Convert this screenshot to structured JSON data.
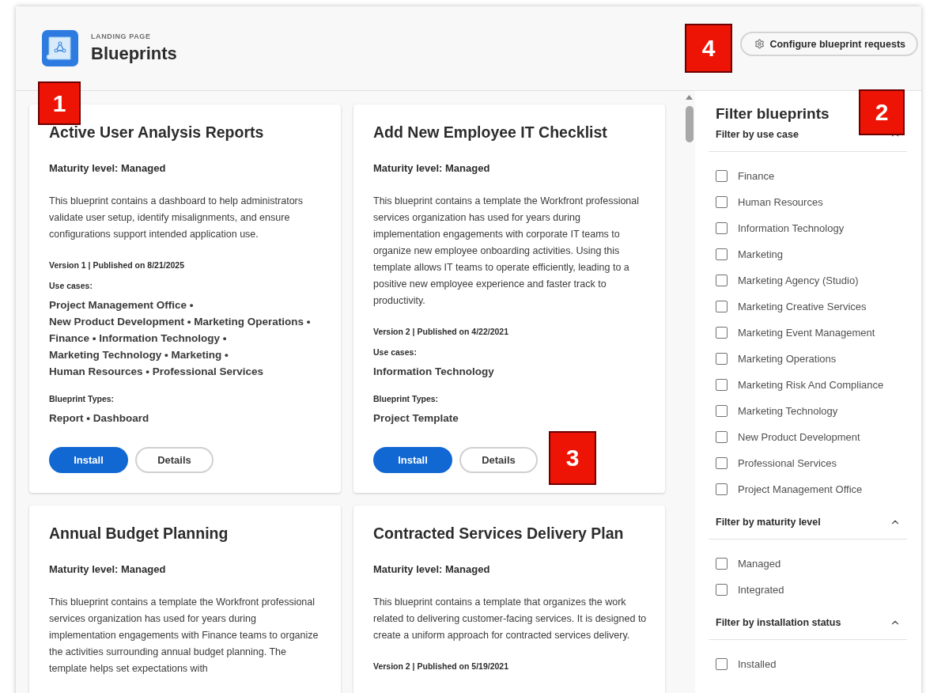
{
  "header": {
    "eyebrow": "LANDING PAGE",
    "title": "Blueprints",
    "action": "Configure blueprint requests"
  },
  "cards": [
    {
      "title": "Active User Analysis Reports",
      "maturity": "Maturity level: Managed",
      "description": "This blueprint contains a dashboard to help administrators validate user setup, identify misalignments, and ensure configurations support intended application use.",
      "version": "Version 1 | Published on 8/21/2025",
      "use_cases_label": "Use cases:",
      "use_cases": [
        "Project Management Office •",
        "New Product Development •",
        "Marketing Operations •",
        "Finance •",
        "Information Technology •",
        "Marketing Technology •",
        "Marketing •",
        "Human Resources •",
        "Professional Services"
      ],
      "types_label": "Blueprint Types:",
      "types": [
        "Report •",
        "Dashboard"
      ],
      "buttons": [
        {
          "label": "Install",
          "kind": "primary"
        },
        {
          "label": "Details",
          "kind": "secondary"
        }
      ]
    },
    {
      "title": "Add New Employee IT Checklist",
      "maturity": "Maturity level: Managed",
      "description": "This blueprint contains a template the Workfront professional services organization has used for years during implementation engagements with corporate IT teams to organize new employee onboarding activities. Using this template allows IT teams to operate efficiently, leading to a positive new employee experience and faster track to productivity.",
      "version": "Version 2 | Published on 4/22/2021",
      "use_cases_label": "Use cases:",
      "use_cases": [
        "Information Technology"
      ],
      "types_label": "Blueprint Types:",
      "types": [
        "Project Template"
      ],
      "buttons": [
        {
          "label": "Install",
          "kind": "primary"
        },
        {
          "label": "Details",
          "kind": "secondary"
        }
      ]
    },
    {
      "title": "Annual Budget Planning",
      "maturity": "Maturity level: Managed",
      "description": "This blueprint contains a template the Workfront professional services organization has used for years during implementation engagements with Finance teams to organize the activities surrounding annual budget planning. The template helps set expectations with"
    },
    {
      "title": "Contracted Services Delivery Plan",
      "maturity": "Maturity level: Managed",
      "description": "This blueprint contains a template that organizes the work related to delivering customer-facing services. It is designed to create a uniform approach for contracted services delivery.",
      "version": "Version 2 | Published on 5/19/2021"
    }
  ],
  "sidebar": {
    "title": "Filter blueprints",
    "sections": [
      {
        "title": "Filter by use case",
        "expanded": true,
        "options": [
          {
            "label": "Finance",
            "checked": false
          },
          {
            "label": "Human Resources",
            "checked": false
          },
          {
            "label": "Information Technology",
            "checked": false
          },
          {
            "label": "Marketing",
            "checked": false
          },
          {
            "label": "Marketing Agency (Studio)",
            "checked": false
          },
          {
            "label": "Marketing Creative Services",
            "checked": false
          },
          {
            "label": "Marketing Event Management",
            "checked": false
          },
          {
            "label": "Marketing Operations",
            "checked": false
          },
          {
            "label": "Marketing Risk And Compliance",
            "checked": false
          },
          {
            "label": "Marketing Technology",
            "checked": false
          },
          {
            "label": "New Product Development",
            "checked": false
          },
          {
            "label": "Professional Services",
            "checked": false
          },
          {
            "label": "Project Management Office",
            "checked": false
          }
        ]
      },
      {
        "title": "Filter by maturity level",
        "expanded": true,
        "options": [
          {
            "label": "Managed",
            "checked": false
          },
          {
            "label": "Integrated",
            "checked": false
          }
        ]
      },
      {
        "title": "Filter by installation status",
        "expanded": true,
        "options": [
          {
            "label": "Installed",
            "checked": false
          }
        ]
      }
    ]
  },
  "callouts": [
    {
      "label": "1"
    },
    {
      "label": "2"
    },
    {
      "label": "3"
    },
    {
      "label": "4"
    }
  ]
}
